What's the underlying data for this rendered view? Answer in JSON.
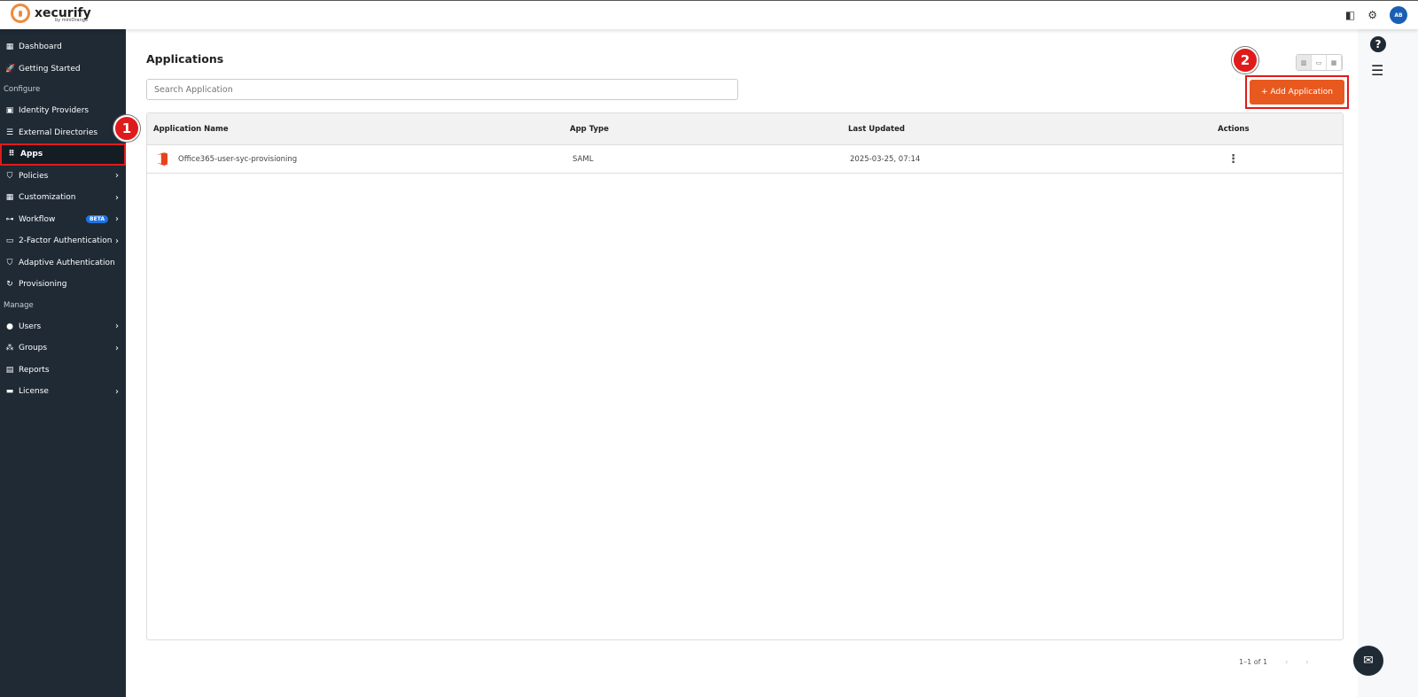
{
  "brand": {
    "name": "xecurify",
    "sub": "by miniOrange"
  },
  "header": {
    "avatar": "AB"
  },
  "sidebar": {
    "items_top": [
      {
        "label": "Dashboard",
        "icon": "▦"
      },
      {
        "label": "Getting Started",
        "icon": "🚀"
      }
    ],
    "section_configure": "Configure",
    "configure": [
      {
        "label": "Identity Providers",
        "icon": "▣"
      },
      {
        "label": "External Directories",
        "icon": "☰"
      },
      {
        "label": "Apps",
        "icon": "⠿"
      },
      {
        "label": "Policies",
        "icon": "⛉"
      },
      {
        "label": "Customization",
        "icon": "▦"
      },
      {
        "label": "Workflow",
        "icon": "⊶",
        "badge": "BETA"
      },
      {
        "label": "2-Factor Authentication",
        "icon": "▭"
      },
      {
        "label": "Adaptive Authentication",
        "icon": "⛉"
      },
      {
        "label": "Provisioning",
        "icon": "↻"
      }
    ],
    "section_manage": "Manage",
    "manage": [
      {
        "label": "Users",
        "icon": "●"
      },
      {
        "label": "Groups",
        "icon": "⁂"
      },
      {
        "label": "Reports",
        "icon": "▤"
      },
      {
        "label": "License",
        "icon": "▬"
      }
    ]
  },
  "main": {
    "title": "Applications",
    "search_placeholder": "Search Application",
    "add_button": "+  Add Application",
    "columns": [
      "Application Name",
      "App Type",
      "Last Updated",
      "Actions"
    ],
    "rows": [
      {
        "name": "Office365-user-syc-provisioning",
        "type": "SAML",
        "updated": "2025-03-25, 07:14",
        "actions": "⋮"
      }
    ],
    "pagination": "1–1 of 1"
  },
  "annotations": [
    "1",
    "2"
  ]
}
